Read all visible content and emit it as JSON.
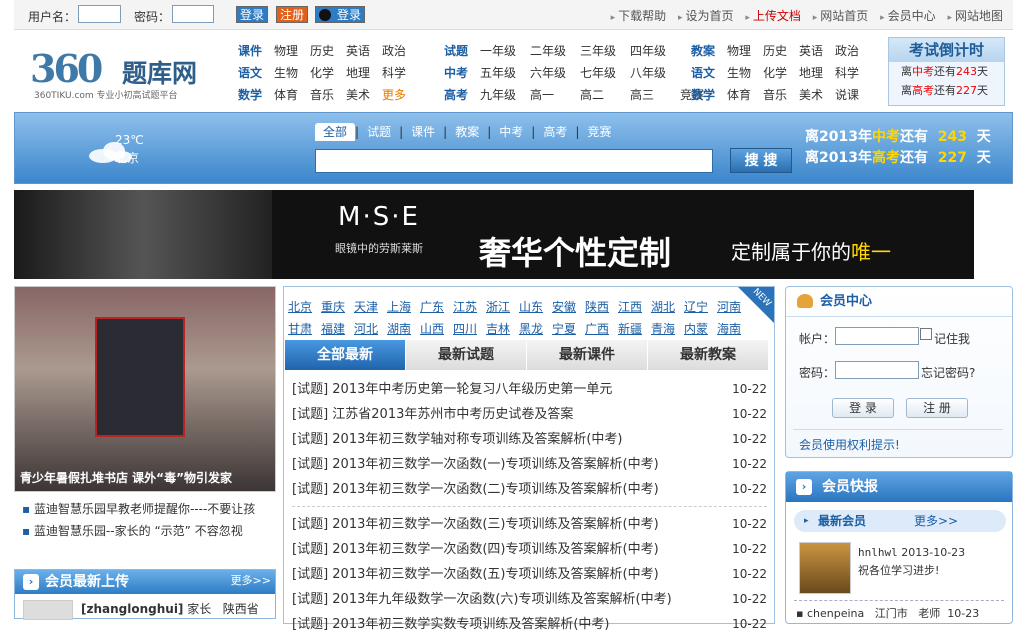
{
  "topbar": {
    "username_label": "用户名：",
    "password_label": "密码：",
    "login_btn": "登录",
    "register_btn": "注册",
    "qq_btn": "登录",
    "links": [
      "下载帮助",
      "设为首页",
      "上传文档",
      "网站首页",
      "会员中心",
      "网站地图"
    ]
  },
  "logo": {
    "number": "360",
    "name": "题库网",
    "slogan": "360TIKU.com 专业小初高试题平台"
  },
  "categories": {
    "course": [
      [
        "课件",
        "物理",
        "历史",
        "英语",
        "政治"
      ],
      [
        "语文",
        "生物",
        "化学",
        "地理",
        "科学"
      ],
      [
        "数学",
        "体育",
        "音乐",
        "美术",
        "更多"
      ]
    ],
    "exam": [
      [
        "试题",
        "一年级",
        "二年级",
        "三年级",
        "四年级"
      ],
      [
        "中考",
        "五年级",
        "六年级",
        "七年级",
        "八年级"
      ],
      [
        "高考",
        "九年级",
        "高一",
        "高二",
        "高三",
        "竞赛"
      ]
    ],
    "plan": [
      [
        "教案",
        "物理",
        "历史",
        "英语",
        "政治"
      ],
      [
        "语文",
        "生物",
        "化学",
        "地理",
        "科学"
      ],
      [
        "数学",
        "体育",
        "音乐",
        "美术",
        "说课"
      ]
    ]
  },
  "countdown_box": {
    "title": "考试倒计时",
    "row1_pre": "离",
    "row1_exam": "中考",
    "row1_mid": "还有",
    "row1_days": "243",
    "row1_post": "天",
    "row2_pre": "离",
    "row2_exam": "高考",
    "row2_mid": "还有",
    "row2_days": "227",
    "row2_post": "天"
  },
  "weather": {
    "temp": "23℃",
    "city": "北京"
  },
  "search": {
    "tabs": [
      "全部",
      "试题",
      "课件",
      "教案",
      "中考",
      "高考",
      "竞赛"
    ],
    "button": "搜 搜",
    "placeholder": ""
  },
  "countdown_big": {
    "line1_pre": "离2013年",
    "line1_exam": "中考",
    "line1_mid": "还有",
    "line1_days": "243",
    "line1_post": "天",
    "line2_pre": "离2013年",
    "line2_exam": "高考",
    "line2_mid": "还有",
    "line2_days": "227",
    "line2_post": "天"
  },
  "banner": {
    "brand": "M·S·E",
    "brand_sub": "眼镜中的劳斯莱斯",
    "headline": "奢华个性定制",
    "tagline_pre": "定制属于你的",
    "tagline_hl": "唯一"
  },
  "left": {
    "book_caption": "青少年暑假扎堆书店 课外“毒”物引发家",
    "links": [
      "蓝迪智慧乐园早教老师提醒你----不要让孩",
      "蓝迪智慧乐园--家长的 “示范” 不容忽视"
    ],
    "upload_title": "会员最新上传",
    "upload_more": "更多>>",
    "upload_user": "[zhanglonghui]",
    "upload_role": "家长",
    "upload_place": "陕西省"
  },
  "provinces": [
    "北京",
    "重庆",
    "天津",
    "上海",
    "广东",
    "江苏",
    "浙江",
    "山东",
    "安徽",
    "陕西",
    "江西",
    "湖北",
    "辽宁",
    "河南",
    "甘肃",
    "福建",
    "河北",
    "湖南",
    "山西",
    "四川",
    "吉林",
    "黑龙",
    "宁夏",
    "广西",
    "新疆",
    "青海",
    "内蒙",
    "海南"
  ],
  "new_tag": "NEW",
  "main_tabs": [
    "全部最新",
    "最新试题",
    "最新课件",
    "最新教案"
  ],
  "news": [
    {
      "t": "[试题] 2013年中考历史第一轮复习八年级历史第一单元",
      "d": "10-22"
    },
    {
      "t": "[试题] 江苏省2013年苏州市中考历史试卷及答案",
      "d": "10-22"
    },
    {
      "t": "[试题] 2013年初三数学轴对称专项训练及答案解析(中考)",
      "d": "10-22"
    },
    {
      "t": "[试题] 2013年初三数学一次函数(一)专项训练及答案解析(中考)",
      "d": "10-22"
    },
    {
      "t": "[试题] 2013年初三数学一次函数(二)专项训练及答案解析(中考)",
      "d": "10-22"
    },
    {
      "t": "[试题] 2013年初三数学一次函数(三)专项训练及答案解析(中考)",
      "d": "10-22"
    },
    {
      "t": "[试题] 2013年初三数学一次函数(四)专项训练及答案解析(中考)",
      "d": "10-22"
    },
    {
      "t": "[试题] 2013年初三数学一次函数(五)专项训练及答案解析(中考)",
      "d": "10-22"
    },
    {
      "t": "[试题] 2013年九年级数学一次函数(六)专项训练及答案解析(中考)",
      "d": "10-22"
    },
    {
      "t": "[试题] 2013年初三数学实数专项训练及答案解析(中考)",
      "d": "10-22"
    }
  ],
  "member": {
    "title": "会员中心",
    "account_label": "帐户：",
    "remember": "记住我",
    "password_label": "密码：",
    "forgot": "忘记密码?",
    "login": "登 录",
    "register": "注 册",
    "rights": "会员使用权利提示!"
  },
  "quick": {
    "title": "会员快报",
    "sub": "最新会员",
    "more": "更多>>",
    "user": "hnlhwl",
    "date": "2013-10-23",
    "msg": "祝各位学习进步!",
    "row2_user": "chenpeina",
    "row2_city": "江门市",
    "row2_role": "老师",
    "row2_date": "10-23"
  }
}
